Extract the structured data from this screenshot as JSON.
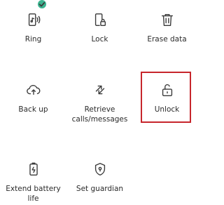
{
  "tiles": {
    "ring": {
      "label": "Ring",
      "icon": "phone-ring-icon",
      "badge": "check-icon"
    },
    "lock": {
      "label": "Lock",
      "icon": "phone-lock-icon"
    },
    "erase": {
      "label": "Erase data",
      "icon": "trash-icon"
    },
    "backup": {
      "label": "Back up",
      "icon": "cloud-upload-icon"
    },
    "retrieve": {
      "label": "Retrieve calls/messages",
      "icon": "arrows-exchange-icon"
    },
    "unlock": {
      "label": "Unlock",
      "icon": "unlock-icon"
    },
    "battery": {
      "label": "Extend battery life",
      "icon": "battery-icon"
    },
    "guardian": {
      "label": "Set guardian",
      "icon": "shield-icon"
    }
  },
  "colors": {
    "highlight": "#c7262c",
    "badge": "#3bb38f",
    "icon": "#3a3a3a",
    "text": "#2b2b2b"
  }
}
